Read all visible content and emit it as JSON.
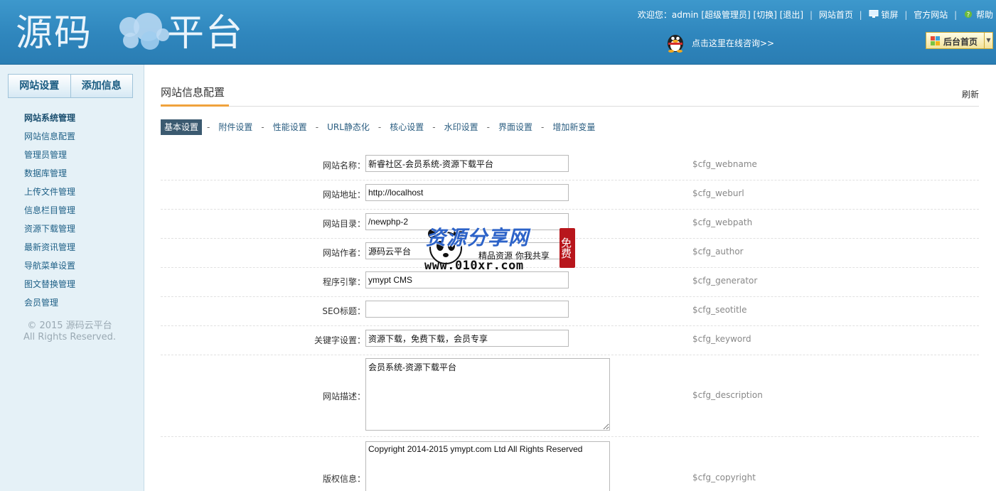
{
  "header": {
    "logo_left": "源码",
    "logo_right": "平台",
    "welcome": "欢迎您：admin",
    "role": "[超级管理员]",
    "switch_label": "[切换]",
    "logout_label": "[退出]",
    "site_home": "网站首页",
    "lock_screen": "锁屏",
    "official_site": "官方网站",
    "help": "帮助",
    "consult": "点击这里在线咨询>>",
    "admin_home": "后台首页"
  },
  "sidebar": {
    "tabs": [
      "网站设置",
      "添加信息"
    ],
    "menu": [
      "网站系统管理",
      "网站信息配置",
      "管理员管理",
      "数据库管理",
      "上传文件管理",
      "信息栏目管理",
      "资源下载管理",
      "最新资讯管理",
      "导航菜单设置",
      "图文替换管理",
      "会员管理"
    ],
    "copyright_line1": "© 2015 源码云平台",
    "copyright_line2": "All Rights Reserved."
  },
  "main": {
    "title": "网站信息配置",
    "refresh": "刷新",
    "tabs": [
      "基本设置",
      "附件设置",
      "性能设置",
      "URL静态化",
      "核心设置",
      "水印设置",
      "界面设置",
      "增加新变量"
    ],
    "fields": [
      {
        "label": "网站名称：",
        "value": "新睿社区-会员系统-资源下载平台",
        "var": "$cfg_webname"
      },
      {
        "label": "网站地址：",
        "value": "http://localhost",
        "var": "$cfg_weburl"
      },
      {
        "label": "网站目录：",
        "value": "/newphp-2",
        "var": "$cfg_webpath"
      },
      {
        "label": "网站作者：",
        "value": "源码云平台",
        "var": "$cfg_author"
      },
      {
        "label": "程序引擎：",
        "value": "ymypt CMS",
        "var": "$cfg_generator"
      },
      {
        "label": "SEO标题：",
        "value": "",
        "var": "$cfg_seotitle"
      },
      {
        "label": "关键字设置：",
        "value": "资源下载，免费下载，会员专享",
        "var": "$cfg_keyword"
      },
      {
        "label": "网站描述：",
        "value": "会员系统-资源下载平台",
        "var": "$cfg_description"
      },
      {
        "label": "版权信息：",
        "value": "Copyright 2014-2015 ymypt.com Ltd All Rights Reserved",
        "var": "$cfg_copyright"
      }
    ]
  },
  "watermark": {
    "line1": "资源分享网",
    "line2": "精品资源 你我共享",
    "line3": "www.010xr.com",
    "badge": "免费"
  },
  "colors": {
    "header_bg": "#2f86bd",
    "sidebar_bg": "#e5f1f7",
    "active_tab": "#3b5a70",
    "accent": "#f0a23c"
  }
}
